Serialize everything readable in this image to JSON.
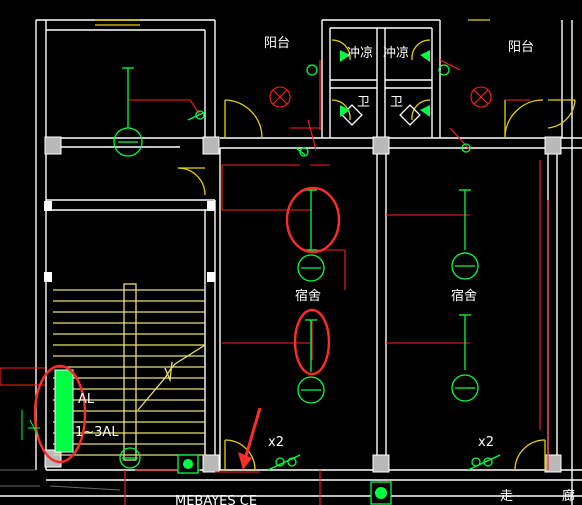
{
  "labels": {
    "balcony_left": "阳台",
    "balcony_right": "阳台",
    "shower_left": "冲凉",
    "shower_right": "冲凉",
    "toilet_left": "卫",
    "toilet_right": "卫",
    "dorm_left": "宿舍",
    "dorm_right": "宿舍",
    "panel_code_a": "AL",
    "panel_code_b": "1~3AL",
    "switch_tag_left": "x2",
    "switch_tag_right": "x2",
    "bottom_code": "MEBAYES CE",
    "corridor_a": "走",
    "corridor_b": "廊"
  },
  "colors": {
    "background": "#000000",
    "wall": "#ffffff",
    "circuit": "#ff2020",
    "fixture": "#00ff44",
    "door": "#e8d200",
    "stair": "#e8e070",
    "highlight": "#ff2a2a",
    "column": "#b9b9b9"
  }
}
